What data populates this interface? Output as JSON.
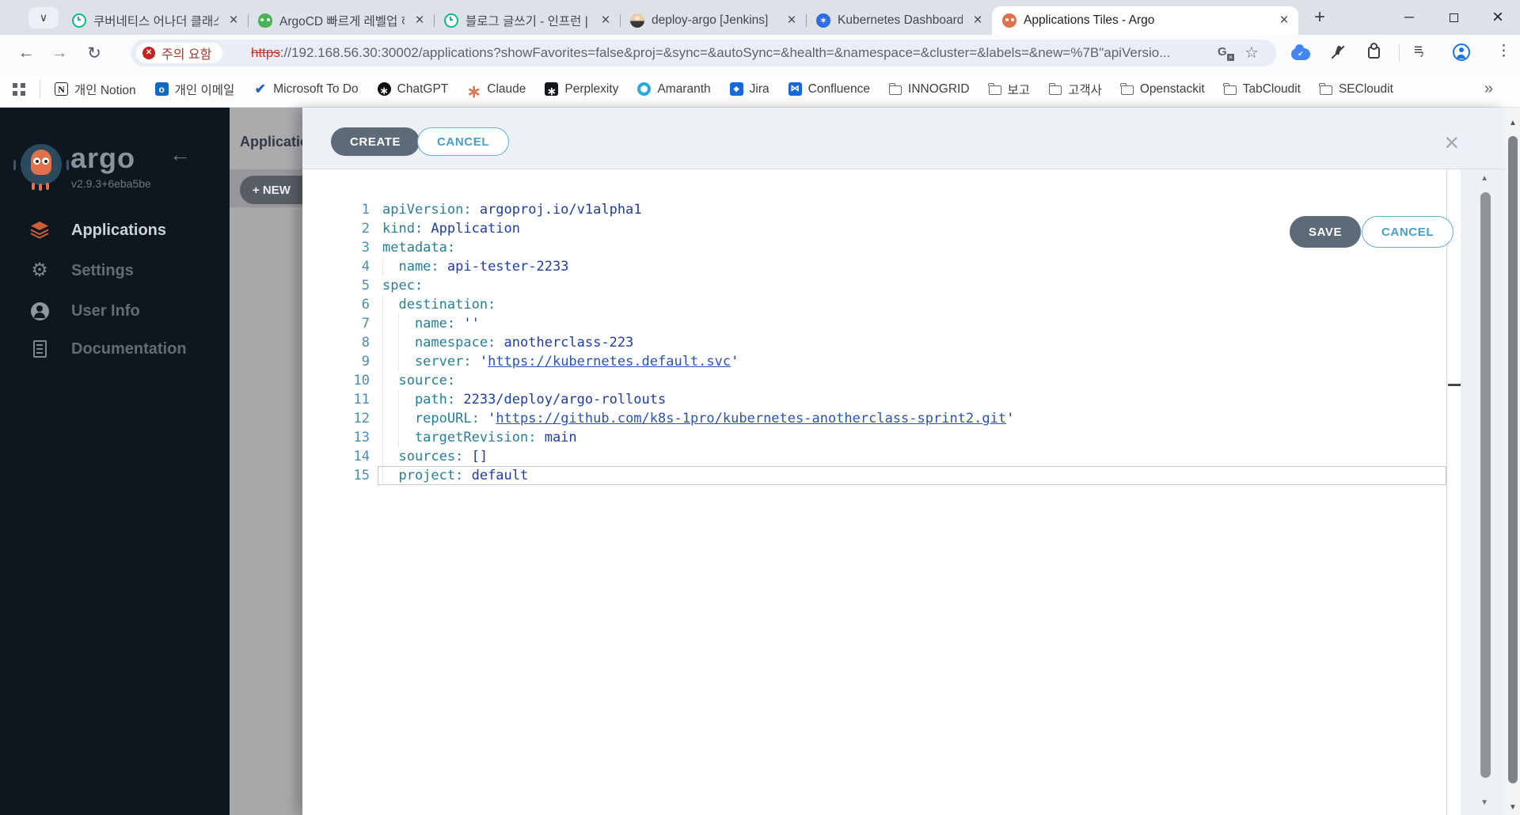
{
  "browser": {
    "tabs": [
      {
        "title": "쿠버네티스 어나더 클래스",
        "icon": "inflearn",
        "active": false
      },
      {
        "title": "ArgoCD 빠르게 레벨업 하",
        "icon": "argocd-green",
        "active": false
      },
      {
        "title": "블로그 글쓰기 - 인프런 | 자",
        "icon": "inflearn",
        "active": false
      },
      {
        "title": "deploy-argo [Jenkins]",
        "icon": "jenkins",
        "active": false
      },
      {
        "title": "Kubernetes Dashboard",
        "icon": "kubernetes",
        "active": false
      },
      {
        "title": "Applications Tiles - Argo",
        "icon": "argo",
        "active": true
      }
    ],
    "address": {
      "security_badge": "주의 요함",
      "url_scheme": "https",
      "url_rest": "://192.168.56.30:30002/applications?showFavorites=false&proj=&sync=&autoSync=&health=&namespace=&cluster=&labels=&new=%7B\"apiVersio..."
    },
    "bookmarks": [
      {
        "label": "개인 Notion",
        "icon": "notion"
      },
      {
        "label": "개인 이메일",
        "icon": "outlook"
      },
      {
        "label": "Microsoft To Do",
        "icon": "todo"
      },
      {
        "label": "ChatGPT",
        "icon": "chatgpt"
      },
      {
        "label": "Claude",
        "icon": "claude"
      },
      {
        "label": "Perplexity",
        "icon": "perplexity"
      },
      {
        "label": "Amaranth",
        "icon": "amaranth"
      },
      {
        "label": "Jira",
        "icon": "jira"
      },
      {
        "label": "Confluence",
        "icon": "confluence"
      },
      {
        "label": "INNOGRID",
        "icon": "folder"
      },
      {
        "label": "보고",
        "icon": "folder"
      },
      {
        "label": "고객사",
        "icon": "folder"
      },
      {
        "label": "Openstackit",
        "icon": "folder"
      },
      {
        "label": "TabCloudit",
        "icon": "folder"
      },
      {
        "label": "SECloudit",
        "icon": "folder"
      }
    ],
    "bookmarks_overflow": "»"
  },
  "sidebar": {
    "logo_text": "argo",
    "version": "v2.9.3+6eba5be",
    "items": [
      {
        "label": "Applications",
        "icon": "layers",
        "active": true
      },
      {
        "label": "Settings",
        "icon": "gear",
        "active": false
      },
      {
        "label": "User Info",
        "icon": "user",
        "active": false
      },
      {
        "label": "Documentation",
        "icon": "doc",
        "active": false
      }
    ]
  },
  "background_page": {
    "title_clipped": "Applicatio",
    "new_button_label": "+ NEW"
  },
  "panel": {
    "create_label": "CREATE",
    "cancel_label": "CANCEL",
    "save_label": "SAVE",
    "cancel2_label": "CANCEL"
  },
  "editor": {
    "lines": [
      {
        "num": 1,
        "indent": 0,
        "segs": [
          [
            "key",
            "apiVersion:"
          ],
          [
            "val",
            " argoproj.io/v1alpha1"
          ]
        ]
      },
      {
        "num": 2,
        "indent": 0,
        "segs": [
          [
            "key",
            "kind:"
          ],
          [
            "val",
            " Application"
          ]
        ]
      },
      {
        "num": 3,
        "indent": 0,
        "segs": [
          [
            "key",
            "metadata:"
          ]
        ]
      },
      {
        "num": 4,
        "indent": 1,
        "segs": [
          [
            "key",
            "name:"
          ],
          [
            "val",
            " api-tester-2233"
          ]
        ]
      },
      {
        "num": 5,
        "indent": 0,
        "segs": [
          [
            "key",
            "spec:"
          ]
        ]
      },
      {
        "num": 6,
        "indent": 1,
        "segs": [
          [
            "key",
            "destination:"
          ]
        ]
      },
      {
        "num": 7,
        "indent": 2,
        "segs": [
          [
            "key",
            "name:"
          ],
          [
            "val",
            " ''"
          ]
        ]
      },
      {
        "num": 8,
        "indent": 2,
        "segs": [
          [
            "key",
            "namespace:"
          ],
          [
            "val",
            " anotherclass-223"
          ]
        ]
      },
      {
        "num": 9,
        "indent": 2,
        "segs": [
          [
            "key",
            "server:"
          ],
          [
            "val",
            " '"
          ],
          [
            "link",
            "https://kubernetes.default.svc"
          ],
          [
            "val",
            "'"
          ]
        ]
      },
      {
        "num": 10,
        "indent": 1,
        "segs": [
          [
            "key",
            "source:"
          ]
        ]
      },
      {
        "num": 11,
        "indent": 2,
        "segs": [
          [
            "key",
            "path:"
          ],
          [
            "val",
            " 2233/deploy/argo-rollouts"
          ]
        ]
      },
      {
        "num": 12,
        "indent": 2,
        "segs": [
          [
            "key",
            "repoURL:"
          ],
          [
            "val",
            " '"
          ],
          [
            "link",
            "https://github.com/k8s-1pro/kubernetes-anotherclass-sprint2.git"
          ],
          [
            "val",
            "'"
          ]
        ]
      },
      {
        "num": 13,
        "indent": 2,
        "segs": [
          [
            "key",
            "targetRevision:"
          ],
          [
            "val",
            " main"
          ]
        ]
      },
      {
        "num": 14,
        "indent": 1,
        "segs": [
          [
            "key",
            "sources:"
          ],
          [
            "val",
            " []"
          ]
        ]
      },
      {
        "num": 15,
        "indent": 1,
        "active": true,
        "segs": [
          [
            "key",
            "project:"
          ],
          [
            "val",
            " default"
          ]
        ]
      }
    ]
  },
  "colors": {
    "accent_teal": "#45a2c6",
    "button_slate": "#5c6b77",
    "argo_orange": "#e0714a",
    "kubernetes_blue": "#326ce5",
    "yaml_key": "#267f99",
    "yaml_value": "#1f3ba6",
    "yaml_link": "#2a52b5",
    "danger_red": "#c5221f",
    "sidebar_bg": "#0e1720"
  }
}
